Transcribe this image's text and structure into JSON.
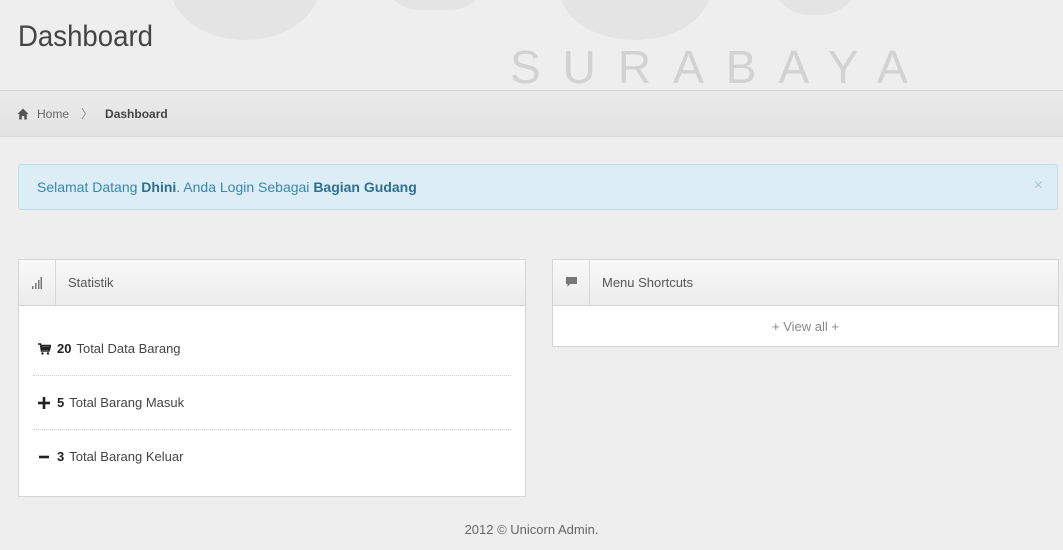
{
  "watermark": {
    "text": "SURABAYA"
  },
  "header": {
    "title": "Dashboard"
  },
  "breadcrumb": {
    "home_icon": "home-icon",
    "home": "Home",
    "separator": "〉",
    "current": "Dashboard"
  },
  "alert": {
    "greeting": "Selamat Datang",
    "user": "Dhini",
    "middle": ". Anda Login Sebagai",
    "role": "Bagian Gudang",
    "close": "×",
    "bg_color": "#dcedf6",
    "text_color": "#3a87ad"
  },
  "stats_widget": {
    "icon": "signal-bars-icon",
    "title": "Statistik",
    "items": [
      {
        "icon": "cart-icon",
        "count": "20",
        "label": "Total Data Barang"
      },
      {
        "icon": "plus-icon",
        "count": "5",
        "label": "Total Barang Masuk"
      },
      {
        "icon": "minus-icon",
        "count": "3",
        "label": "Total Barang Keluar"
      }
    ]
  },
  "shortcuts_widget": {
    "icon": "comment-icon",
    "title": "Menu Shortcuts",
    "view_all": "+ View all +"
  },
  "footer": {
    "text": "2012 © Unicorn Admin."
  }
}
